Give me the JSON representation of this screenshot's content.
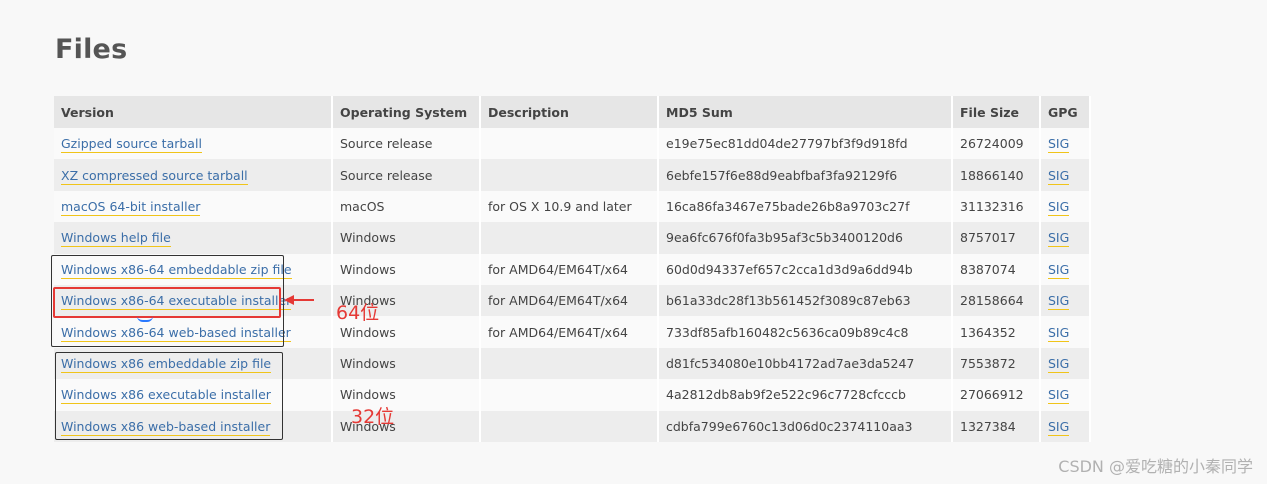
{
  "title": "Files",
  "columns": [
    "Version",
    "Operating System",
    "Description",
    "MD5 Sum",
    "File Size",
    "GPG"
  ],
  "rows": [
    {
      "version": "Gzipped source tarball",
      "os": "Source release",
      "description": "",
      "md5": "e19e75ec81dd04de27797bf3f9d918fd",
      "size": "26724009",
      "gpg": "SIG"
    },
    {
      "version": "XZ compressed source tarball",
      "os": "Source release",
      "description": "",
      "md5": "6ebfe157f6e88d9eabfbaf3fa92129f6",
      "size": "18866140",
      "gpg": "SIG"
    },
    {
      "version": "macOS 64-bit installer",
      "os": "macOS",
      "description": "for OS X 10.9 and later",
      "md5": "16ca86fa3467e75bade26b8a9703c27f",
      "size": "31132316",
      "gpg": "SIG"
    },
    {
      "version": "Windows help file",
      "os": "Windows",
      "description": "",
      "md5": "9ea6fc676f0fa3b95af3c5b3400120d6",
      "size": "8757017",
      "gpg": "SIG"
    },
    {
      "version": "Windows x86-64 embeddable zip file",
      "os": "Windows",
      "description": "for AMD64/EM64T/x64",
      "md5": "60d0d94337ef657c2cca1d3d9a6dd94b",
      "size": "8387074",
      "gpg": "SIG"
    },
    {
      "version": "Windows x86-64 executable installer",
      "os": "Windows",
      "description": "for AMD64/EM64T/x64",
      "md5": "b61a33dc28f13b561452f3089c87eb63",
      "size": "28158664",
      "gpg": "SIG"
    },
    {
      "version": "Windows x86-64 web-based installer",
      "os": "Windows",
      "description": "for AMD64/EM64T/x64",
      "md5": "733df85afb160482c5636ca09b89c4c8",
      "size": "1364352",
      "gpg": "SIG"
    },
    {
      "version": "Windows x86 embeddable zip file",
      "os": "Windows",
      "description": "",
      "md5": "d81fc534080e10bb4172ad7ae3da5247",
      "size": "7553872",
      "gpg": "SIG"
    },
    {
      "version": "Windows x86 executable installer",
      "os": "Windows",
      "description": "",
      "md5": "4a2812db8ab9f2e522c96c7728cfcccb",
      "size": "27066912",
      "gpg": "SIG"
    },
    {
      "version": "Windows x86 web-based installer",
      "os": "Windows",
      "description": "",
      "md5": "cdbfa799e6760c13d06d0c2374110aa3",
      "size": "1327384",
      "gpg": "SIG"
    }
  ],
  "annotations": {
    "label_64": "64位",
    "label_32": "32位",
    "highlight_color": "#e53935"
  },
  "watermark": "CSDN @爱吃糖的小秦同学",
  "colors": {
    "link": "#3b6ea8",
    "link_underline": "#f0c419",
    "header_bg": "#e6e6e6"
  }
}
